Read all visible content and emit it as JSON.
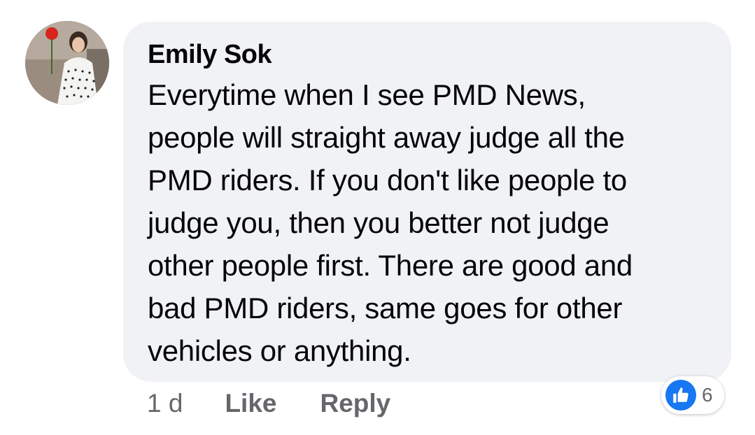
{
  "comment": {
    "author": "Emily Sok",
    "text": "Everytime when I see PMD News, people will straight away judge all the PMD riders. If you don't like people to judge you, then you better not judge other people first. There are good and bad PMD riders, same goes for other vehicles or anything.",
    "lines": [
      "Everytime when I see PMD News,",
      "people will straight away judge all the",
      "PMD riders. If you don't like people to",
      "judge you, then you better not judge",
      "other people first. There are good and",
      "bad PMD riders, same goes for other",
      "vehicles or anything."
    ]
  },
  "actions": {
    "timestamp": "1 d",
    "like_label": "Like",
    "reply_label": "Reply"
  },
  "reactions": {
    "icon": "thumbs-up-icon",
    "count": "6",
    "color": "#1877f2"
  },
  "colors": {
    "bubble_bg": "#f0f2f5",
    "text": "#050505",
    "secondary_text": "#65676b",
    "accent": "#1877f2"
  }
}
